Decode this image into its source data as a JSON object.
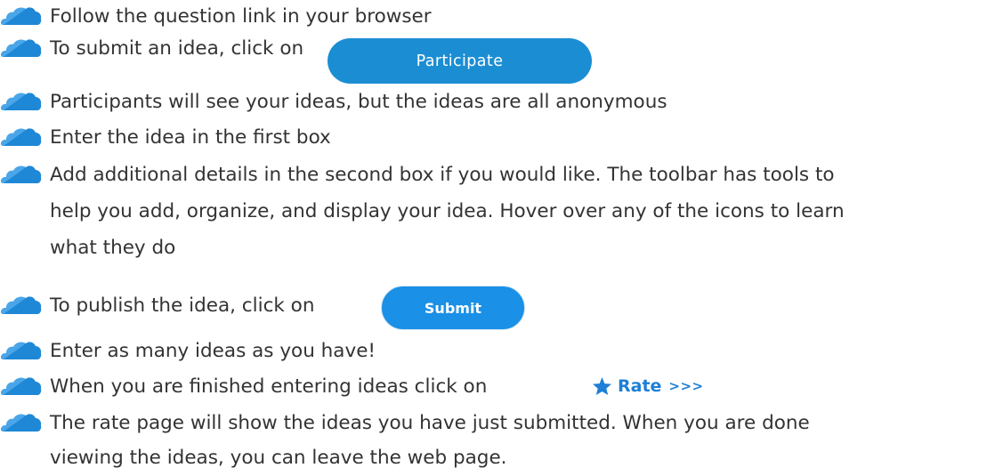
{
  "instructions": [
    {
      "text": "Follow the question link in your browser"
    },
    {
      "text": "To submit an idea, click on"
    },
    {
      "text": "Participants will see your ideas, but the ideas are all anonymous"
    },
    {
      "text": "Enter the idea in the first box"
    },
    {
      "text": "Add additional details in the second box if you would like. The toolbar has tools to"
    },
    {
      "text": "help you add, organize, and display your idea. Hover over any of the icons to learn"
    },
    {
      "text": "what they do"
    },
    {
      "text": "To publish the idea, click on"
    },
    {
      "text": "Enter as many ideas as you have!"
    },
    {
      "text": "When you are finished entering ideas click on"
    },
    {
      "text": "The rate page will show the ideas you have just submitted. When you are done"
    },
    {
      "text": "viewing the ideas, you can leave the web page."
    }
  ],
  "buttons": {
    "participate_label": "Participate",
    "submit_label": "Submit",
    "rate_label": "Rate",
    "rate_suffix": ">>>"
  },
  "colors": {
    "bullet_cloud": "#1f88d6",
    "participate_bg": "#1b8ed3",
    "submit_bg": "#1a90e6",
    "rate_text": "#1d7fd6",
    "body_text": "#333333"
  },
  "icons": {
    "bullet": "cloud-icon",
    "rate": "star-icon"
  }
}
